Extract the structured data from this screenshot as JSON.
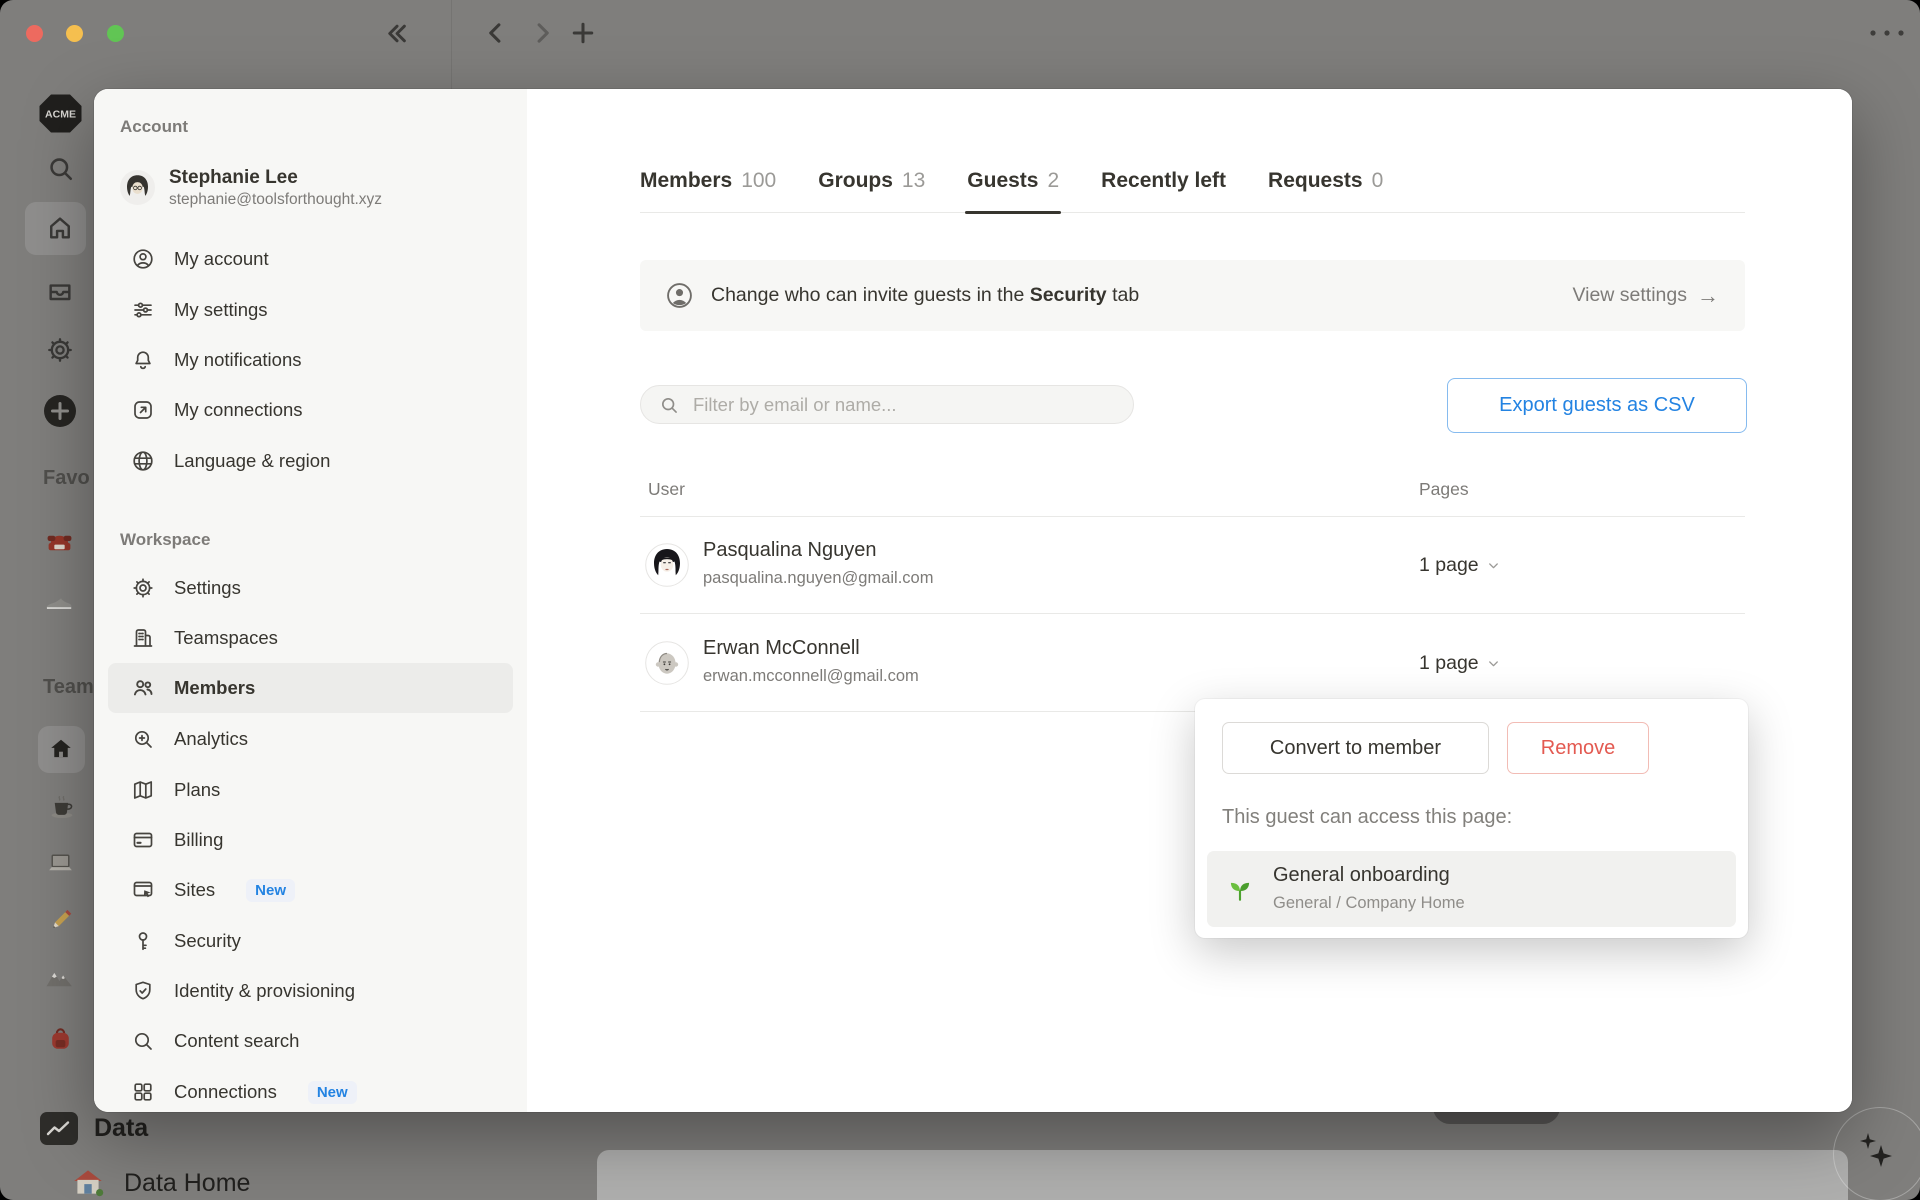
{
  "titlebar": {
    "traffic_lights": [
      "close",
      "minimize",
      "zoom"
    ],
    "icons": [
      "collapse-sidebar",
      "back",
      "forward",
      "new-tab",
      "more"
    ]
  },
  "workspace_nav": {
    "logo_text": "ACME",
    "favorites_label": "Favo",
    "teamspaces_label": "Team",
    "data_label": "Data",
    "data_home_label": "Data Home"
  },
  "settings_sidebar": {
    "account_section_label": "Account",
    "profile": {
      "name": "Stephanie Lee",
      "email": "stephanie@toolsforthought.xyz"
    },
    "account_items": [
      {
        "label": "My account",
        "icon": "person-circle"
      },
      {
        "label": "My settings",
        "icon": "sliders"
      },
      {
        "label": "My notifications",
        "icon": "bell"
      },
      {
        "label": "My connections",
        "icon": "arrow-out-box"
      },
      {
        "label": "Language & region",
        "icon": "globe"
      }
    ],
    "workspace_section_label": "Workspace",
    "workspace_items": [
      {
        "label": "Settings",
        "icon": "gear"
      },
      {
        "label": "Teamspaces",
        "icon": "building"
      },
      {
        "label": "Members",
        "icon": "people",
        "active": true
      },
      {
        "label": "Analytics",
        "icon": "magnifier-plus"
      },
      {
        "label": "Plans",
        "icon": "map"
      },
      {
        "label": "Billing",
        "icon": "credit-card"
      },
      {
        "label": "Sites",
        "icon": "browser-cursor",
        "badge": "New"
      },
      {
        "label": "Security",
        "icon": "key"
      },
      {
        "label": "Identity & provisioning",
        "icon": "shield-check"
      },
      {
        "label": "Content search",
        "icon": "magnifier"
      },
      {
        "label": "Connections",
        "icon": "grid",
        "badge": "New"
      }
    ]
  },
  "members_page": {
    "tabs": [
      {
        "label": "Members",
        "count": "100",
        "active": false
      },
      {
        "label": "Groups",
        "count": "13",
        "active": false
      },
      {
        "label": "Guests",
        "count": "2",
        "active": true
      },
      {
        "label": "Recently left",
        "count": "",
        "active": false
      },
      {
        "label": "Requests",
        "count": "0",
        "active": false
      }
    ],
    "banner": {
      "text_before": "Change who can invite guests in the ",
      "text_bold": "Security",
      "text_after": " tab",
      "action_label": "View settings",
      "action_arrow": "→"
    },
    "filter_placeholder": "Filter by email or name...",
    "export_button": "Export guests as CSV",
    "table": {
      "user_header": "User",
      "pages_header": "Pages",
      "rows": [
        {
          "name": "Pasqualina Nguyen",
          "email": "pasqualina.nguyen@gmail.com",
          "pages": "1 page"
        },
        {
          "name": "Erwan McConnell",
          "email": "erwan.mcconnell@gmail.com",
          "pages": "1 page"
        }
      ]
    },
    "popup": {
      "convert_button": "Convert to member",
      "remove_button": "Remove",
      "caption": "This guest can access this page:",
      "page": {
        "icon": "sprout",
        "title": "General onboarding",
        "breadcrumb": "General / Company Home"
      }
    }
  },
  "colors": {
    "accent_blue": "#2383e2",
    "danger_red": "#e35a51",
    "text_primary": "#37352f",
    "text_secondary": "#7d7b78",
    "sidebar_bg": "#f7f7f5",
    "highlight_bg": "#ececea",
    "dim_overlay": "#7f7e7c"
  }
}
